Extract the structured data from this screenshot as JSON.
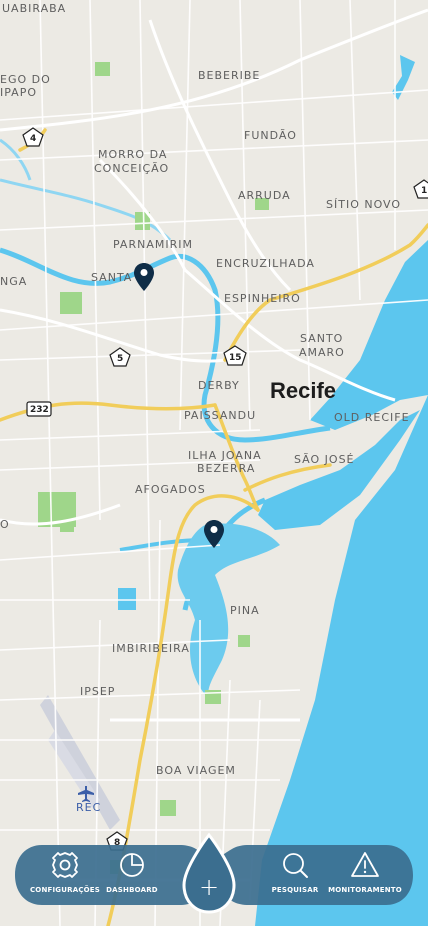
{
  "map": {
    "neighborhoods": [
      "UABIRABA",
      "EGO DO",
      "IPAPO",
      "BEBERIBE",
      "FUNDÃO",
      "MORRO DA",
      "CONCEIÇÃO",
      "ARRUDA",
      "SÍTIO NOVO",
      "PARNAMIRIM",
      "ENCRUZILHADA",
      "SANTA",
      "ESPINHEIRO",
      "NGA",
      "SANTO",
      "AMARO",
      "DERBY",
      "PAISSANDU",
      "OLD RECIFE",
      "ILHA JOANA",
      "BEZERRA",
      "SÃO JOSÉ",
      "AFOGADOS",
      "PINA",
      "IMBIRIBEIRA",
      "IPSEP",
      "BOA VIAGEM",
      "REC",
      "O"
    ],
    "city": "Recife",
    "shields": [
      "4",
      "5",
      "15",
      "232",
      "8",
      "1"
    ],
    "colors": {
      "land": "#eceae4",
      "water": "#5cc6ee",
      "park": "#9fd68a",
      "major_road": "#f1cd5a"
    }
  },
  "pins": [
    {
      "name": "location-pin-santana"
    },
    {
      "name": "location-pin-pina"
    }
  ],
  "nav": {
    "config_label": "CONFIGURAÇÕES",
    "dashboard_label": "DASHBOARD",
    "add_label": "+",
    "search_label": "PESQUISAR",
    "monitor_label": "MONITORAMENTO",
    "colors": {
      "bar": "#3b6e8f",
      "icon": "#ffffff"
    }
  }
}
